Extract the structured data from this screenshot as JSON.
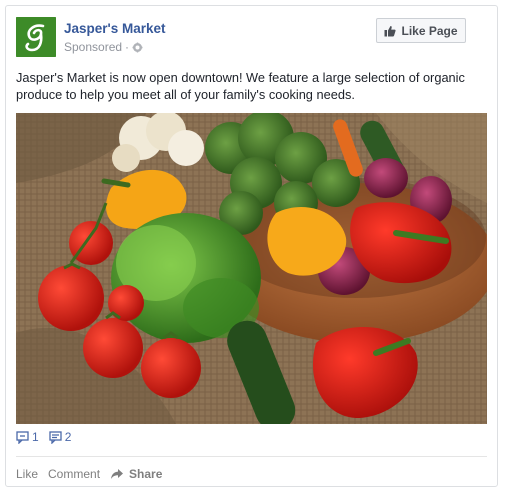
{
  "post": {
    "page_name": "Jasper's Market",
    "sponsored_label": "Sponsored",
    "separator": "·",
    "like_page_label": "Like Page",
    "text": "Jasper's Market is now open downtown! We feature a large selection of organic produce to help you meet all of your family's cooking needs.",
    "image_description_icon": "vegetables-photo"
  },
  "counts": {
    "likes": "1",
    "comments": "2"
  },
  "actions": {
    "like": "Like",
    "comment": "Comment",
    "share": "Share"
  },
  "colors": {
    "brand_link": "#365899",
    "logo_green": "#3d8b28",
    "meta_gray": "#90949c"
  }
}
